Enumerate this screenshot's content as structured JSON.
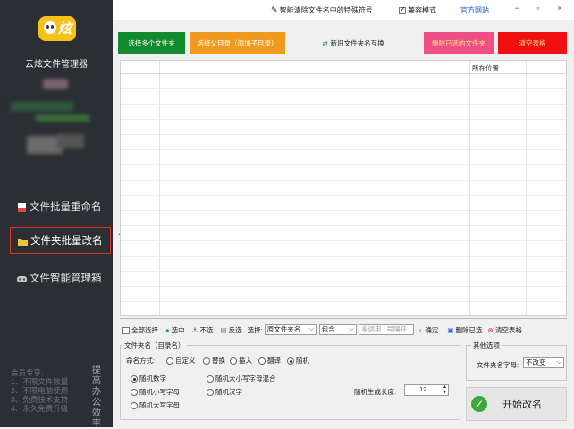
{
  "sidebar": {
    "logo_text": "炫",
    "app_name": "云炫文件管理器",
    "nav": [
      {
        "label": "文件批量重命名",
        "icon": "document-icon"
      },
      {
        "label": "文件夹批量改名",
        "icon": "folder-icon"
      },
      {
        "label": "文件智能管理箱",
        "icon": "gamepad-icon"
      }
    ],
    "promo_lines": "会员专享:\n1、不限文件数量\n2、不限电脑使用\n3、免费技术支持\n4、永久免费升级",
    "promo_vertical": "提高办公效率"
  },
  "titlebar": {
    "special_chars": "智能清除文件名中的特殊符号",
    "compat_mode": "兼容模式",
    "compat_checked": true,
    "website": "官方网站",
    "win_buttons": [
      "−",
      "▫",
      "×"
    ]
  },
  "actions": {
    "select_folders": "选择多个文件夹",
    "select_parent": "选择父目录（添加子目录）",
    "swap_names": "新旧文件夹名互换",
    "delete_selected": "删除已选的文件夹",
    "clear_table": "清空表格"
  },
  "table": {
    "column_location": "所在位置"
  },
  "toolbar": {
    "select_all": "全部选择",
    "select": "选中",
    "deselect": "不选",
    "invert": "反选",
    "choose_label": "选择:",
    "field_value": "原文件夹名",
    "match_value": "包含",
    "keywords_placeholder": "多词用 | 号隔开",
    "confirm": "确定",
    "delete_selected": "删除已选",
    "clear_table": "清空表格"
  },
  "naming": {
    "group_title": "文件夹名（目录名）",
    "mode_label": "命名方式:",
    "modes": [
      "自定义",
      "替换",
      "插入",
      "翻译",
      "随机"
    ],
    "selected_mode": "随机",
    "random_options": [
      "随机数字",
      "随机大小写字母混合",
      "随机小写字母",
      "随机汉字",
      "随机大写字母"
    ],
    "selected_random": "随机数字",
    "length_label": "随机生成长度:",
    "length_value": "12"
  },
  "other": {
    "group_title": "其他选项",
    "case_label": "文件夹名字母:",
    "case_value": "不改变"
  },
  "start_button": "开始改名"
}
